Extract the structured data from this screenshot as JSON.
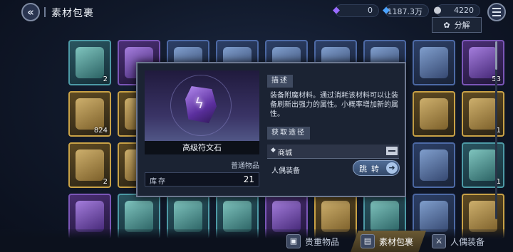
{
  "header": {
    "title": "素材包裹",
    "currency": [
      {
        "icon": "purple-gem-icon",
        "value": "0",
        "color": "#9a6bff"
      },
      {
        "icon": "blue-crystal-icon",
        "value": "1187.3万",
        "color": "#4ba3ff"
      },
      {
        "icon": "silver-ore-icon",
        "value": "4220",
        "color": "#c8ccd6"
      }
    ],
    "decompose_label": "分解"
  },
  "grid": {
    "items": [
      {
        "quality": "teal",
        "count": "2"
      },
      {
        "quality": "purple",
        "count": ""
      },
      {
        "quality": "blue",
        "count": ""
      },
      {
        "quality": "blue",
        "count": ""
      },
      {
        "quality": "blue",
        "count": ""
      },
      {
        "quality": "blue",
        "count": ""
      },
      {
        "quality": "blue",
        "count": ""
      },
      {
        "quality": "blue",
        "count": ""
      },
      {
        "quality": "purple",
        "count": "53"
      },
      {
        "quality": "gold",
        "count": "824"
      },
      {
        "quality": "gold",
        "count": ""
      },
      {
        "quality": "blue",
        "count": ""
      },
      {
        "quality": "blue",
        "count": ""
      },
      {
        "quality": "blue",
        "count": ""
      },
      {
        "quality": "blue",
        "count": ""
      },
      {
        "quality": "blue",
        "count": ""
      },
      {
        "quality": "gold",
        "count": ""
      },
      {
        "quality": "gold",
        "count": "1"
      },
      {
        "quality": "gold",
        "count": "2"
      },
      {
        "quality": "gold",
        "count": ""
      },
      {
        "quality": "blue",
        "count": ""
      },
      {
        "quality": "blue",
        "count": ""
      },
      {
        "quality": "blue",
        "count": ""
      },
      {
        "quality": "blue",
        "count": ""
      },
      {
        "quality": "blue",
        "count": ""
      },
      {
        "quality": "blue",
        "count": ""
      },
      {
        "quality": "teal",
        "count": "1"
      },
      {
        "quality": "purple",
        "count": ""
      },
      {
        "quality": "teal",
        "count": ""
      },
      {
        "quality": "teal",
        "count": ""
      },
      {
        "quality": "teal",
        "count": ""
      },
      {
        "quality": "purple",
        "count": ""
      },
      {
        "quality": "gold",
        "count": ""
      },
      {
        "quality": "teal",
        "count": ""
      },
      {
        "quality": "blue",
        "count": ""
      },
      {
        "quality": "gold",
        "count": ""
      }
    ]
  },
  "detail": {
    "name": "高级符文石",
    "rarity": "普通物品",
    "stock_label": "库存",
    "stock_value": "21",
    "desc_title": "描述",
    "description": "装备附魔材料。通过消耗该材料可以让装备刷新出强力的属性。小概率增加新的属性。",
    "source_title": "获取途径",
    "source_label": "商城",
    "equip_label": "人偶装备",
    "jump_label": "跳转"
  },
  "tabs": [
    {
      "label": "贵重物品",
      "icon": "treasure-chest-icon",
      "active": false
    },
    {
      "label": "素材包裹",
      "icon": "material-box-icon",
      "active": true
    },
    {
      "label": "人偶装备",
      "icon": "sword-icon",
      "active": false
    }
  ]
}
